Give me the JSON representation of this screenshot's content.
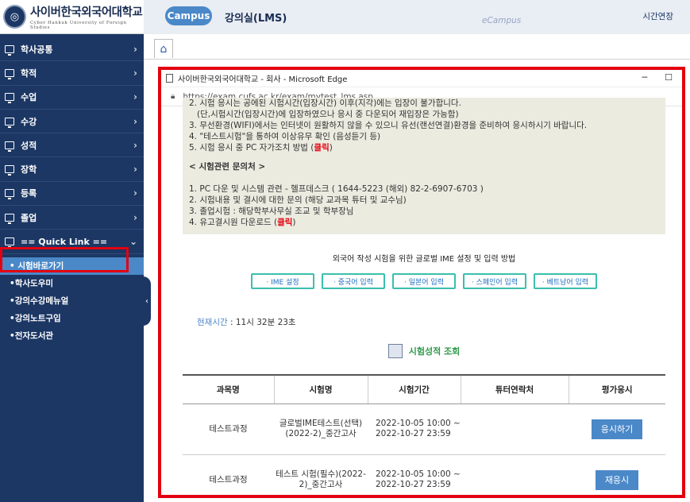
{
  "sidebar": {
    "logo_title": "사이버한국외국어대학교",
    "logo_sub": "Cyber Hankuk University of Foreign Studies",
    "menu": [
      {
        "label": "학사공통"
      },
      {
        "label": "학적"
      },
      {
        "label": "수업"
      },
      {
        "label": "수강"
      },
      {
        "label": "성적"
      },
      {
        "label": "장학"
      },
      {
        "label": "등록"
      },
      {
        "label": "졸업"
      },
      {
        "label": "== Quick Link =="
      }
    ],
    "quick_links": [
      {
        "label": "• 시험바로가기"
      },
      {
        "label": "•학사도우미"
      },
      {
        "label": "•강의수강메뉴얼"
      },
      {
        "label": "•강의노트구입"
      },
      {
        "label": "•전자도서관"
      }
    ]
  },
  "header": {
    "campus_label": "Campus",
    "title": "강의실(LMS)",
    "ecampus": "eCampus",
    "time_extend": "시간연장"
  },
  "popup": {
    "window_title": "사이버한국외국어대학교 - 회사 - Microsoft Edge",
    "url": "https://exam.cufs.ac.kr/exam/mytest_lms.asp",
    "notice": {
      "line_partial": "2. 시험 응시는 공에된 시험시간(입장시간) 이후(지각)에는 입장이 불가합니다.",
      "line_2b": "(단,시험시간(입장시간)에 입장하였으나 응시 중 다운되어 재입장은 가능함)",
      "line_3": "3. 무선환경(WIFI)에서는 인터넷이 원활하지 않을 수 있으니 유선(랜선연결)환경을 준비하여 응시하시기 바랍니다.",
      "line_4": "4. \"테스트시험\"을 통하여 이상유무 확인 (음성듣기 등)",
      "line_5_prefix": "5. 시험 응시 중 PC 자가조치 방법 (",
      "click": "클릭",
      "close_paren": ")",
      "contact_head": "< 시험관련 문의처 >",
      "c1": "1. PC 다운 및 시스템 관련 - 헬프데스크 ( 1644-5223 (해외) 82-2-6907-6703 )",
      "c2": "2. 시험내용 및 결시에 대한 문의 (해당 교과목 튜터 및 교수님)",
      "c3": "3. 졸업시험 : 해당학부사무실 조교 및 학부장님",
      "c4_prefix": "4. 유고결시원 다운로드 ("
    },
    "ime_title": "외국어 작성 시험을 위한 글로벌 IME 설정 및 입력 방법",
    "ime_buttons": [
      "· IME 설정",
      "· 중국어 입력",
      "· 일본어 입력",
      "· 스페인어 입력",
      "· 베트남어 입력"
    ],
    "current_time_label": "현재시간",
    "current_time_value": " : 11시 32분 23초",
    "results_label": "시험성적 조회",
    "table": {
      "headers": [
        "과목명",
        "시험명",
        "시험기간",
        "튜터연락처",
        "평가응시"
      ],
      "rows": [
        {
          "course": "테스트과정",
          "exam": "글로벌IME테스트(선택)(2022-2)_중간고사",
          "period_start": "2022-10-05 10:00 ~",
          "period_end": "2022-10-27 23:59",
          "tutor": "",
          "action": "응시하기"
        },
        {
          "course": "테스트과정",
          "exam": "테스트 시험(필수)(2022-2)_중간고사",
          "period_start": "2022-10-05 10:00 ~",
          "period_end": "2022-10-27 23:59",
          "tutor": "",
          "action": "재응시"
        }
      ]
    }
  }
}
